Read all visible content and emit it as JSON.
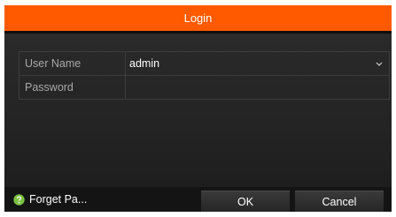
{
  "dialog": {
    "title": "Login",
    "accent_color": "#ff5a00"
  },
  "form": {
    "username_label": "User Name",
    "username_value": "admin",
    "password_label": "Password",
    "password_value": ""
  },
  "footer": {
    "forget_label": "Forget Pa...",
    "forget_icon": "help-icon",
    "ok_label": "OK",
    "cancel_label": "Cancel"
  }
}
